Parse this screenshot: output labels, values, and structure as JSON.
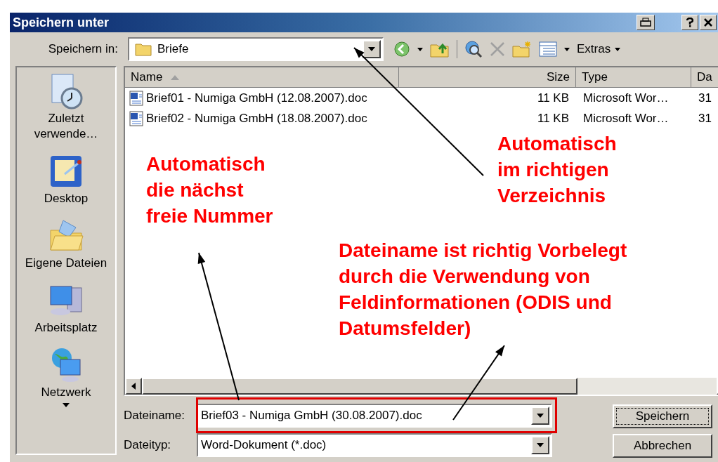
{
  "window": {
    "title": "Speichern unter"
  },
  "toolbar": {
    "save_in_label": "Speichern in:",
    "folder": "Briefe",
    "tools_label": "Extras"
  },
  "places": [
    {
      "label": "Zuletzt verwende…",
      "kind": "recent"
    },
    {
      "label": "Desktop",
      "kind": "desktop"
    },
    {
      "label": "Eigene Dateien",
      "kind": "documents"
    },
    {
      "label": "Arbeitsplatz",
      "kind": "computer"
    },
    {
      "label": "Netzwerk",
      "kind": "network"
    }
  ],
  "file_list": {
    "columns": [
      "Name",
      "Size",
      "Type",
      "Da"
    ],
    "rows": [
      {
        "cells": [
          "Brief01 - Numiga GmbH (12.08.2007).doc",
          "11 KB",
          "Microsoft Wor…",
          "31"
        ]
      },
      {
        "cells": [
          "Brief02 - Numiga GmbH (18.08.2007).doc",
          "11 KB",
          "Microsoft Wor…",
          "31"
        ]
      }
    ]
  },
  "filename": {
    "label": "Dateiname:",
    "value": "Brief03 - Numiga GmbH (30.08.2007).doc"
  },
  "filetype": {
    "label": "Dateityp:",
    "value": "Word-Dokument (*.doc)"
  },
  "buttons": [
    {
      "label": "Speichern",
      "focused": true
    },
    {
      "label": "Abbrechen",
      "focused": false
    }
  ],
  "annotations": [
    {
      "text": "Automatisch\nim richtigen\nVerzeichnis"
    },
    {
      "text": "Automatisch\ndie nächst\nfreie Nummer"
    },
    {
      "text": "Dateiname ist richtig Vorbelegt\ndurch die Verwendung von\nFeldinformationen (ODIS und\nDatumsfelder)"
    }
  ]
}
